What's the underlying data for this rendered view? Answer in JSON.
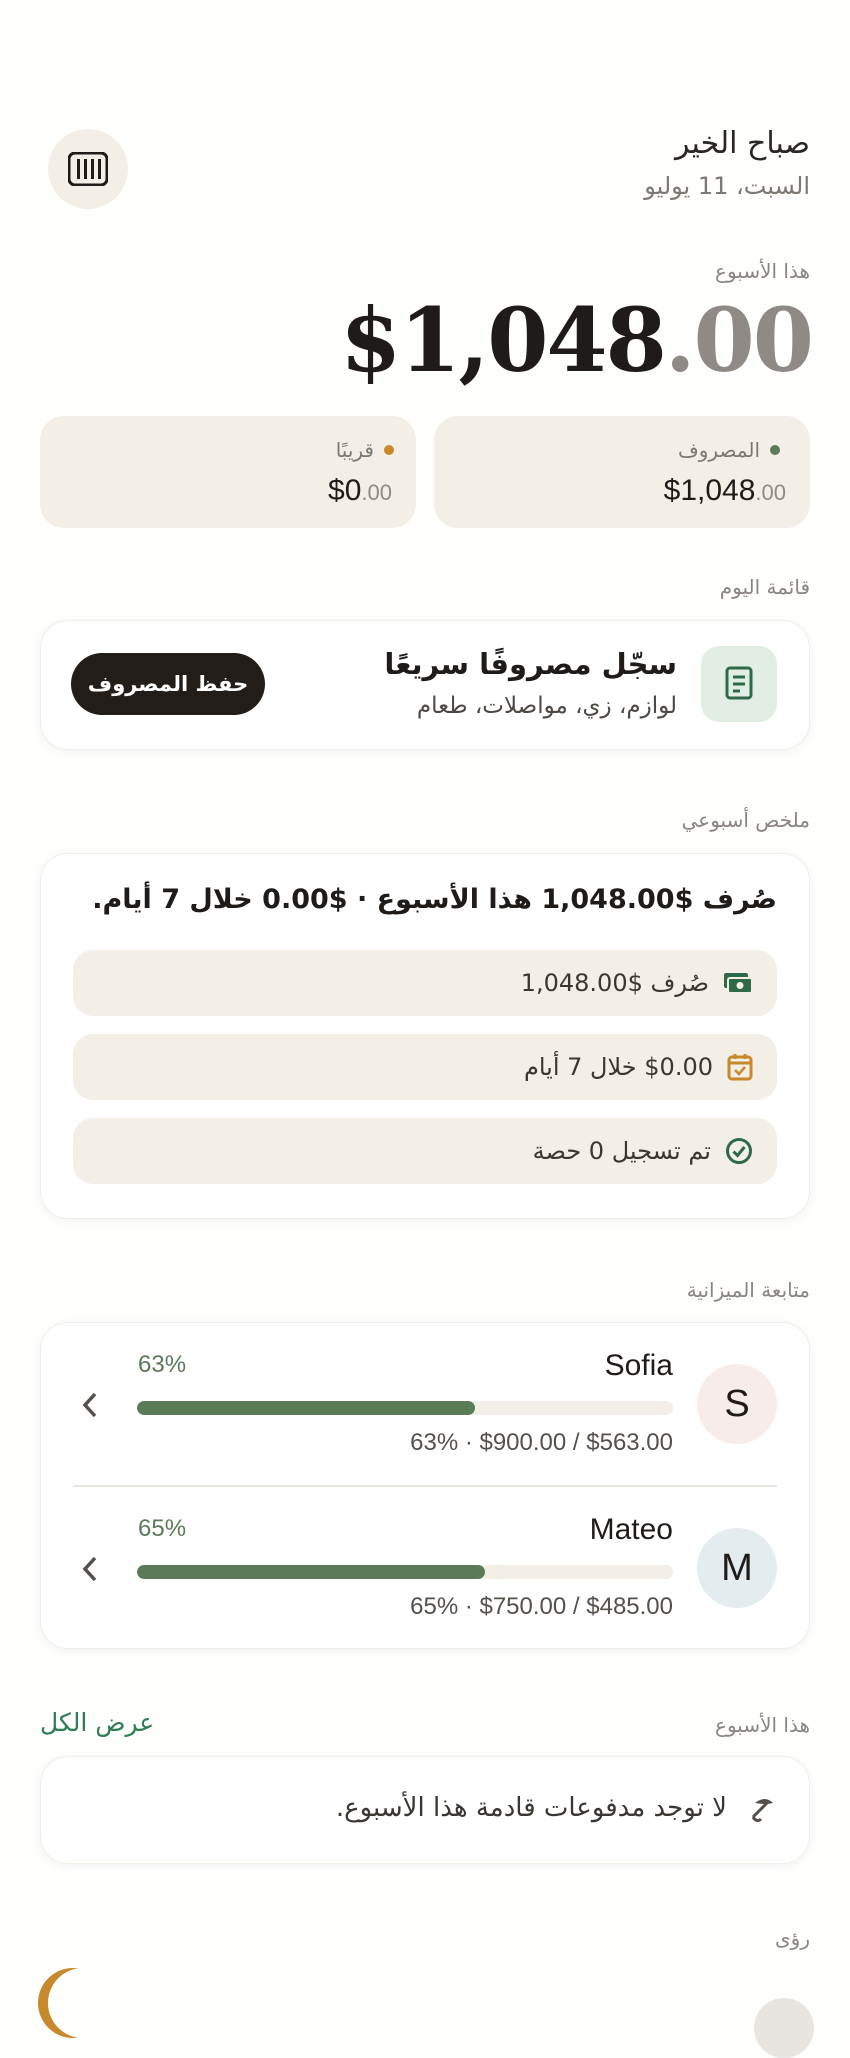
{
  "header": {
    "greeting": "صباح الخير",
    "date": "السبت، 11 يوليو"
  },
  "week": {
    "label": "هذا الأسبوع",
    "total_main": "$1,048",
    "total_cents": ".00"
  },
  "stats": {
    "spent_label": "المصروف",
    "spent_main": "$1,048",
    "spent_cents": ".00",
    "soon_label": "قريبًا",
    "soon_main": "$0",
    "soon_cents": ".00"
  },
  "today": {
    "section_label": "قائمة اليوم",
    "title": "سجّل مصروفًا سريعًا",
    "subtitle": "لوازم، زي، مواصلات، طعام",
    "save_button": "حفظ المصروف"
  },
  "weekly_summary": {
    "section_label": "ملخص أسبوعي",
    "headline": "صُرف $1,048.00 هذا الأسبوع · $0.00 خلال 7 أيام.",
    "rows": [
      {
        "text": "صُرف $1,048.00",
        "icon": "cash-icon"
      },
      {
        "text": "$0.00 خلال 7 أيام",
        "icon": "calendar-icon"
      },
      {
        "text": "تم تسجيل 0 حصة",
        "icon": "check-circle-icon"
      }
    ]
  },
  "budget": {
    "section_label": "متابعة الميزانية",
    "people": [
      {
        "initial": "S",
        "name": "Sofia",
        "percent_label": "63%",
        "percent": 63,
        "detail": "63% · $900.00 / $563.00",
        "avatar_color": "#f8ecea"
      },
      {
        "initial": "M",
        "name": "Mateo",
        "percent_label": "65%",
        "percent": 65,
        "detail": "65% · $750.00 / $485.00",
        "avatar_color": "#e3edf0"
      }
    ]
  },
  "payments": {
    "section_label": "هذا الأسبوع",
    "view_all": "عرض الكل",
    "empty_text": "لا توجد مدفوعات قادمة هذا الأسبوع."
  },
  "insights": {
    "section_label": "رؤى"
  },
  "colors": {
    "accent_green": "#5a7b57",
    "accent_orange": "#c8892c",
    "beige": "#f3efe7",
    "dark": "#1f1b18"
  }
}
